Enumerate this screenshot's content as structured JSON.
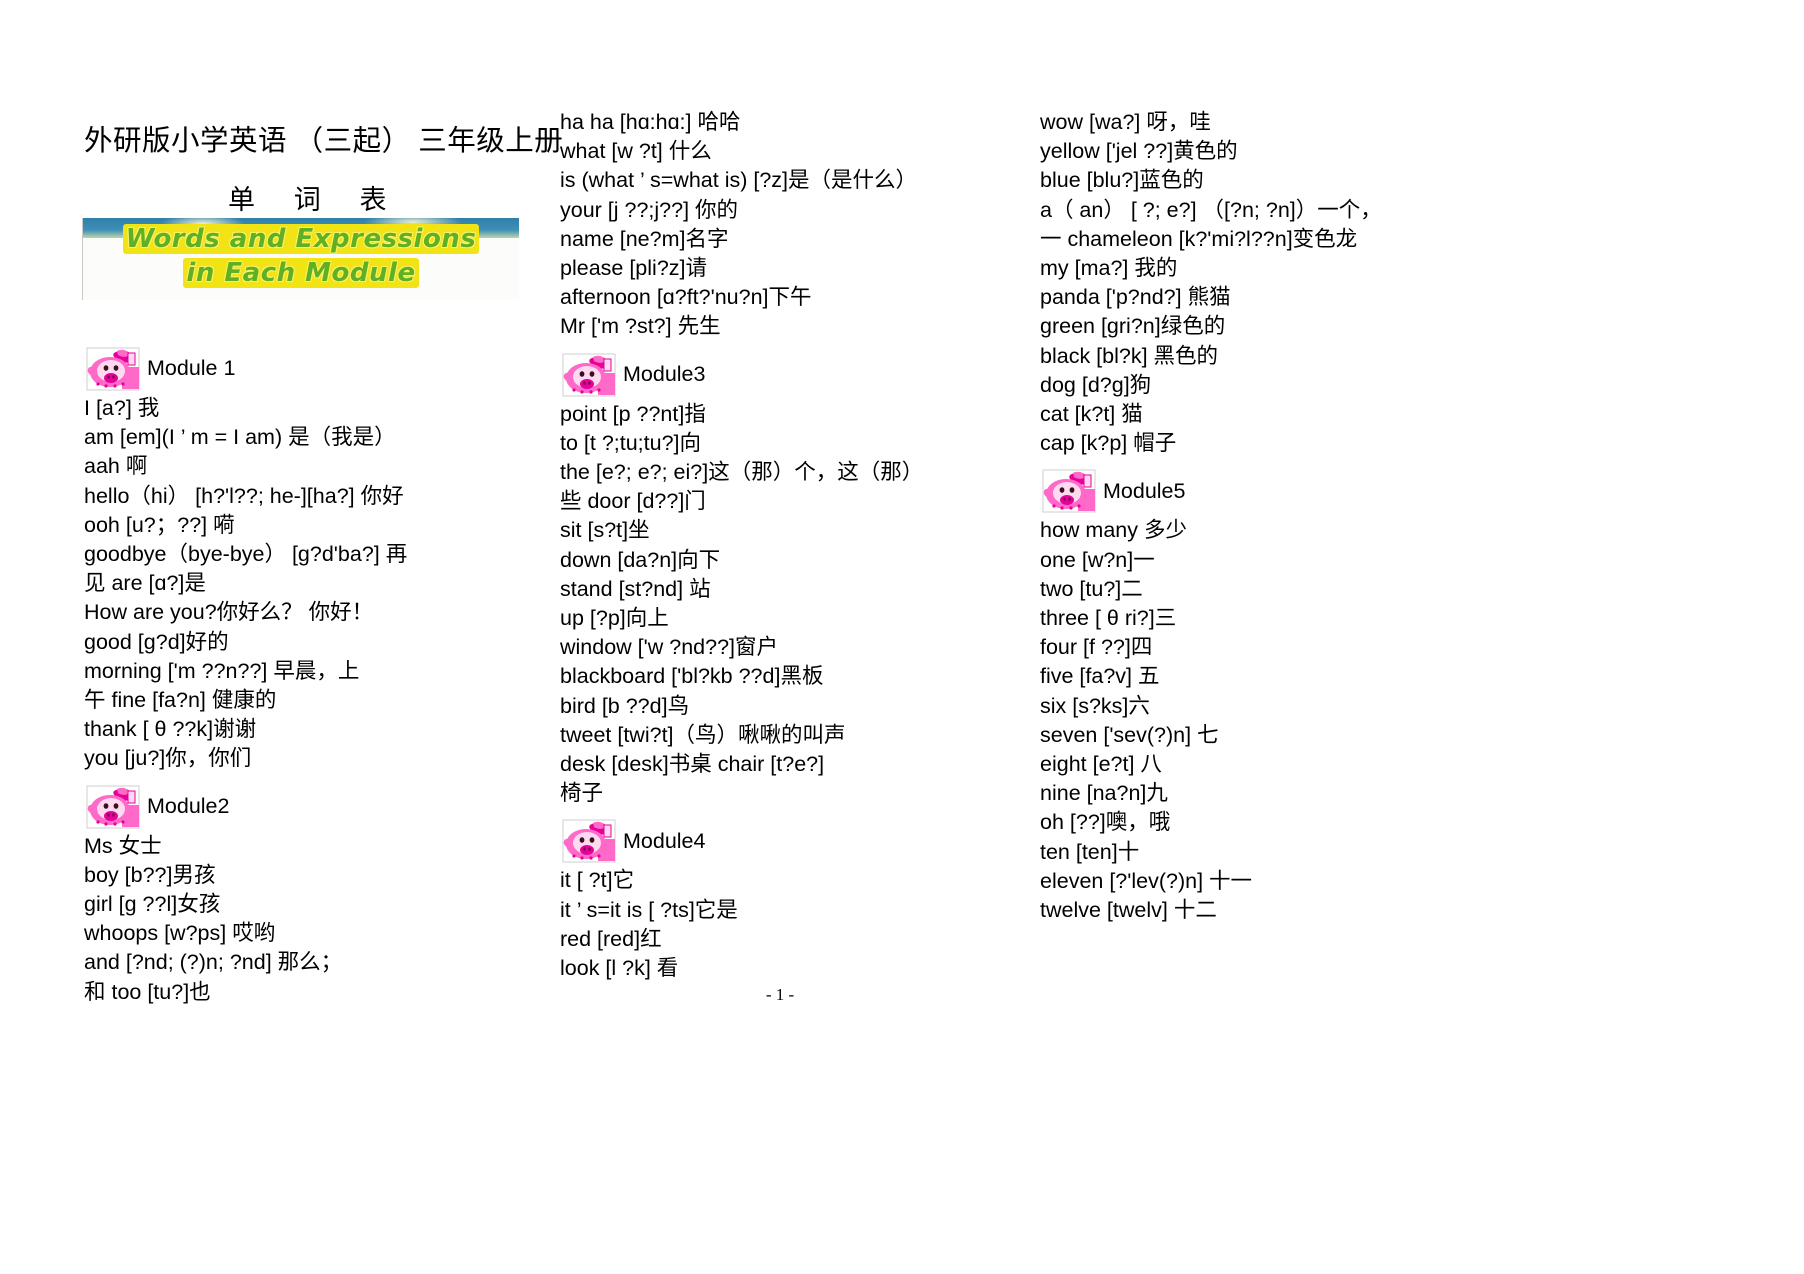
{
  "document": {
    "title_main": "外研版小学英语 （三起） 三年级上册",
    "title_sub": "单 词 表",
    "page_number": "- 1 -"
  },
  "banner": {
    "line1": "Words and Expressions",
    "line2": "in Each Module",
    "text_color": "#5fb022",
    "highlight_color": "#f2e315",
    "sky_color": "#3f90b8"
  },
  "icon": {
    "name": "pig-icon",
    "body_color": "#ff69c8",
    "face_color": "#ffd9f0",
    "accent_color": "#e8009b"
  },
  "columns": [
    {
      "id": "column-1",
      "blocks": [
        {
          "type": "module",
          "label": "Module 1",
          "entries": [
            "I [a?] 我",
            "am [em](I ’ m = I am) 是（我是）",
            "aah 啊",
            "hello（hi） [h?'l??; he-][ha?] 你好",
            "ooh [u?；??] 嗬",
            "goodbye（bye-bye） [g?d'ba?] 再",
            "见 are [ɑ?]是",
            "How are you?你好么？ 你好！",
            "good [g?d]好的",
            "morning ['m ??n??] 早晨，上",
            " 午 fine [fa?n] 健康的",
            "thank [ θ ??k]谢谢",
            "you [ju?]你，你们"
          ]
        },
        {
          "type": "module",
          "label": "Module2",
          "entries": [
            "Ms 女士",
            "boy [b??]男孩",
            "girl [g ??l]女孩",
            "whoops [w?ps] 哎哟",
            "and [?nd; (?)n; ?nd] 那么；",
            "和 too [tu?]也"
          ]
        }
      ]
    },
    {
      "id": "column-2",
      "blocks": [
        {
          "type": "plain",
          "entries": [
            "ha ha [hɑ:hɑ:] 哈哈",
            "what [w ?t] 什么",
            "is (what ’ s=what is) [?z]是（是什么）",
            "your [j ??;j??] 你的",
            "name [ne?m]名字",
            "please [pli?z]请",
            "afternoon [ɑ?ft?'nu?n]下午",
            "Mr ['m ?st?] 先生"
          ]
        },
        {
          "type": "module",
          "label": "Module3",
          "entries": [
            "point [p ??nt]指",
            "to [t ?;tu;tu?]向",
            "the [e?; e?; ei?]这（那）个，这（那）",
            "些 door [d??]门",
            "sit [s?t]坐",
            "down [da?n]向下",
            "stand [st?nd] 站",
            "up [?p]向上",
            "window ['w ?nd??]窗户",
            "blackboard ['bl?kb ??d]黑板",
            "bird [b ??d]鸟",
            "tweet [twi?t]（鸟）啾啾的叫声",
            "desk [desk]书桌 chair [t?e?]",
            "椅子"
          ]
        },
        {
          "type": "module",
          "label": "Module4",
          "entries": [
            "it [ ?t]它",
            "it ’ s=it is [ ?ts]它是",
            "red [red]红",
            "look [l ?k] 看"
          ]
        }
      ]
    },
    {
      "id": "column-3",
      "blocks": [
        {
          "type": "plain",
          "entries": [
            "wow [wa?] 呀，哇",
            "yellow ['jel ??]黄色的",
            "blue [blu?]蓝色的",
            "a（ an） [ ?; e?] （[?n; ?n]）一个，",
            "一 chameleon [k?'mi?l??n]变色龙",
            "my [ma?] 我的",
            "panda ['p?nd?] 熊猫",
            "green [gri?n]绿色的",
            "black [bl?k] 黑色的",
            "dog [d?g]狗",
            "cat [k?t] 猫",
            "cap [k?p] 帽子"
          ]
        },
        {
          "type": "module",
          "label": "Module5",
          "entries": [
            "how many 多少",
            "one [w?n]一",
            "two [tu?]二",
            "three [ θ ri?]三",
            "four [f ??]四",
            "five [fa?v] 五",
            "six [s?ks]六",
            "seven ['sev(?)n] 七",
            "eight [e?t] 八",
            "nine [na?n]九",
            "oh [??]噢，哦",
            "ten [ten]十",
            "eleven [?'lev(?)n] 十一",
            "twelve [twelv] 十二"
          ]
        }
      ]
    }
  ]
}
